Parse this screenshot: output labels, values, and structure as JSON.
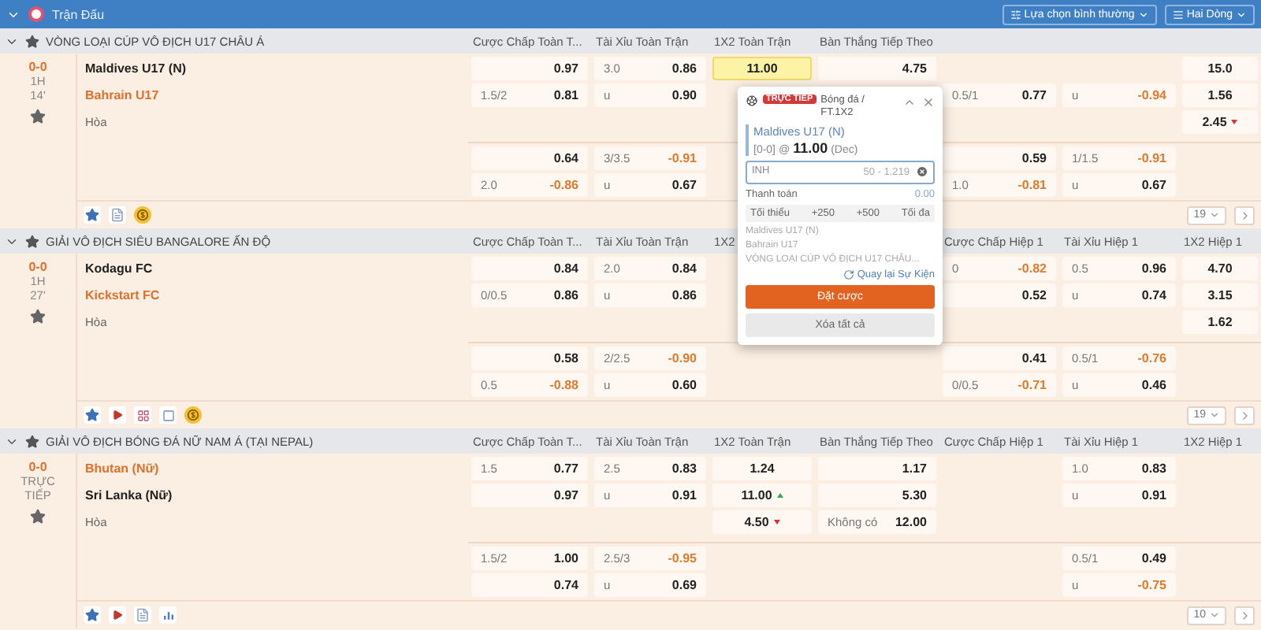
{
  "topbar": {
    "title": "Trận Đấu",
    "options": [
      {
        "label": "Lựa chọn bình thường",
        "kind": "filter"
      },
      {
        "label": "Hai Dòng",
        "kind": "lines"
      }
    ]
  },
  "sections": [
    {
      "league": "VÒNG LOẠI CÚP VÔ ĐỊCH U17 CHÂU Á",
      "columns": [
        {
          "label": "Cược Chấp Toàn T...",
          "kind": "handicap"
        },
        {
          "label": "Tài Xỉu Toàn Trận",
          "kind": "total"
        },
        {
          "label": "1X2 Toàn Trận",
          "kind": "threeway"
        },
        {
          "label": "Bàn Thắng Tiếp Theo",
          "kind": "nextgoal"
        },
        {
          "kind": "handicap"
        },
        {
          "kind": "total"
        },
        {
          "kind": "threeway"
        }
      ],
      "score": "0-0",
      "status": [
        "1H",
        "14'"
      ],
      "teams": [
        {
          "name": "Maldives U17 (N)",
          "highlight": false
        },
        {
          "name": "Bahrain U17",
          "highlight": true
        }
      ],
      "draw": "Hòa",
      "blocks": [
        {
          "rows": [
            [
              {
                "odds": "0.97",
                "negative": false,
                "selected": false
              },
              {
                "line": "3.0",
                "odds": "0.86",
                "negative": false,
                "selected": false
              },
              {
                "odds": "11.00",
                "negative": false,
                "selected": true
              },
              {
                "odds": "4.75",
                "negative": false,
                "selected": false
              },
              null,
              null,
              {
                "odds": "15.0",
                "negative": false,
                "selected": false
              }
            ],
            [
              {
                "line": "1.5/2",
                "odds": "0.81",
                "negative": false,
                "selected": false
              },
              {
                "line": "u",
                "odds": "0.90",
                "negative": false,
                "selected": false
              },
              null,
              null,
              {
                "line": "0.5/1",
                "odds": "0.77",
                "negative": false,
                "selected": false
              },
              {
                "line": "u",
                "odds": "-0.94",
                "negative": true,
                "selected": false
              },
              {
                "odds": "1.56",
                "negative": false,
                "selected": false
              }
            ],
            [
              null,
              null,
              null,
              null,
              null,
              null,
              {
                "odds": "2.45",
                "negative": false,
                "selected": false,
                "trend": {
                  "kind": "down"
                }
              }
            ]
          ]
        },
        {
          "rows": [
            [
              {
                "odds": "0.64",
                "negative": false,
                "selected": false
              },
              {
                "line": "3/3.5",
                "odds": "-0.91",
                "negative": true,
                "selected": false
              },
              null,
              null,
              {
                "odds": "0.59",
                "negative": false,
                "selected": false
              },
              {
                "line": "1/1.5",
                "odds": "-0.91",
                "negative": true,
                "selected": false
              },
              null
            ],
            [
              {
                "line": "2.0",
                "odds": "-0.86",
                "negative": true,
                "selected": false
              },
              {
                "line": "u",
                "odds": "0.67",
                "negative": false,
                "selected": false
              },
              null,
              null,
              {
                "line": "1.0",
                "odds": "-0.81",
                "negative": true,
                "selected": false
              },
              {
                "line": "u",
                "odds": "0.67",
                "negative": false,
                "selected": false
              },
              null
            ]
          ]
        }
      ],
      "tools": [
        {
          "kind": "star"
        },
        {
          "kind": "list"
        },
        {
          "kind": "coin"
        }
      ],
      "page_size": "19"
    },
    {
      "league": "GIẢI VÔ ĐỊCH SIÊU BANGALORE ẤN ĐỘ",
      "columns": [
        {
          "label": "Cược Chấp Toàn T...",
          "kind": "handicap"
        },
        {
          "label": "Tài Xỉu Toàn Trận",
          "kind": "total"
        },
        {
          "label": "1X2",
          "kind": "threeway"
        },
        {
          "kind": "nextgoal"
        },
        {
          "label": "Cược Chấp Hiệp 1",
          "kind": "handicap"
        },
        {
          "label": "Tài Xỉu Hiệp 1",
          "kind": "total"
        },
        {
          "label": "1X2 Hiệp 1",
          "kind": "threeway"
        }
      ],
      "score": "0-0",
      "status": [
        "1H",
        "27'"
      ],
      "teams": [
        {
          "name": "Kodagu FC",
          "highlight": false
        },
        {
          "name": "Kickstart FC",
          "highlight": true
        }
      ],
      "draw": "Hòa",
      "blocks": [
        {
          "rows": [
            [
              {
                "odds": "0.84",
                "negative": false,
                "selected": false
              },
              {
                "line": "2.0",
                "odds": "0.84",
                "negative": false,
                "selected": false
              },
              null,
              null,
              {
                "line": "0",
                "odds": "-0.82",
                "negative": true,
                "selected": false
              },
              {
                "line": "0.5",
                "odds": "0.96",
                "negative": false,
                "selected": false
              },
              {
                "odds": "4.70",
                "negative": false,
                "selected": false
              }
            ],
            [
              {
                "line": "0/0.5",
                "odds": "0.86",
                "negative": false,
                "selected": false
              },
              {
                "line": "u",
                "odds": "0.86",
                "negative": false,
                "selected": false
              },
              null,
              null,
              {
                "odds": "0.52",
                "negative": false,
                "selected": false
              },
              {
                "line": "u",
                "odds": "0.74",
                "negative": false,
                "selected": false
              },
              {
                "odds": "3.15",
                "negative": false,
                "selected": false
              }
            ],
            [
              null,
              null,
              null,
              null,
              null,
              null,
              {
                "odds": "1.62",
                "negative": false,
                "selected": false
              }
            ]
          ]
        },
        {
          "rows": [
            [
              {
                "odds": "0.58",
                "negative": false,
                "selected": false
              },
              {
                "line": "2/2.5",
                "odds": "-0.90",
                "negative": true,
                "selected": false
              },
              null,
              null,
              {
                "odds": "0.41",
                "negative": false,
                "selected": false
              },
              {
                "line": "0.5/1",
                "odds": "-0.76",
                "negative": true,
                "selected": false
              },
              null
            ],
            [
              {
                "line": "0.5",
                "odds": "-0.88",
                "negative": true,
                "selected": false
              },
              {
                "line": "u",
                "odds": "0.60",
                "negative": false,
                "selected": false
              },
              null,
              null,
              {
                "line": "0/0.5",
                "odds": "-0.71",
                "negative": true,
                "selected": false
              },
              {
                "line": "u",
                "odds": "0.46",
                "negative": false,
                "selected": false
              },
              null
            ]
          ]
        }
      ],
      "tools": [
        {
          "kind": "star"
        },
        {
          "kind": "play"
        },
        {
          "kind": "grid"
        },
        {
          "kind": "square"
        },
        {
          "kind": "coin"
        }
      ],
      "page_size": "19"
    },
    {
      "league": "GIẢI VÔ ĐỊCH BÓNG ĐÁ NỮ NAM Á (TẠI NEPAL)",
      "columns": [
        {
          "label": "Cược Chấp Toàn T...",
          "kind": "handicap"
        },
        {
          "label": "Tài Xỉu Toàn Trận",
          "kind": "total"
        },
        {
          "label": "1X2 Toàn Trận",
          "kind": "threeway"
        },
        {
          "label": "Bàn Thắng Tiếp Theo",
          "kind": "nextgoal"
        },
        {
          "label": "Cược Chấp Hiệp 1",
          "kind": "handicap"
        },
        {
          "label": "Tài Xỉu Hiệp 1",
          "kind": "total"
        },
        {
          "label": "1X2 Hiệp 1",
          "kind": "threeway"
        }
      ],
      "score": "0-0",
      "status": [
        "TRỰC",
        "TIẾP"
      ],
      "teams": [
        {
          "name": "Bhutan (Nữ)",
          "highlight": true
        },
        {
          "name": "Sri Lanka (Nữ)",
          "highlight": false
        }
      ],
      "draw": "Hòa",
      "blocks": [
        {
          "rows": [
            [
              {
                "line": "1.5",
                "odds": "0.77",
                "negative": false,
                "selected": false
              },
              {
                "line": "2.5",
                "odds": "0.83",
                "negative": false,
                "selected": false
              },
              {
                "odds": "1.24",
                "negative": false,
                "selected": false
              },
              {
                "odds": "1.17",
                "negative": false,
                "selected": false
              },
              null,
              {
                "line": "1.0",
                "odds": "0.83",
                "negative": false,
                "selected": false
              },
              null
            ],
            [
              {
                "odds": "0.97",
                "negative": false,
                "selected": false
              },
              {
                "line": "u",
                "odds": "0.91",
                "negative": false,
                "selected": false
              },
              {
                "odds": "11.00",
                "negative": false,
                "selected": false,
                "trend": {
                  "kind": "up"
                }
              },
              {
                "odds": "5.30",
                "negative": false,
                "selected": false
              },
              null,
              {
                "line": "u",
                "odds": "0.91",
                "negative": false,
                "selected": false
              },
              null
            ],
            [
              null,
              null,
              {
                "odds": "4.50",
                "negative": false,
                "selected": false,
                "trend": {
                  "kind": "down"
                }
              },
              {
                "line": "Không có",
                "odds": "12.00",
                "negative": false,
                "selected": false
              },
              null,
              null,
              null
            ]
          ]
        },
        {
          "rows": [
            [
              {
                "line": "1.5/2",
                "odds": "1.00",
                "negative": false,
                "selected": false
              },
              {
                "line": "2.5/3",
                "odds": "-0.95",
                "negative": true,
                "selected": false
              },
              null,
              null,
              null,
              {
                "line": "0.5/1",
                "odds": "0.49",
                "negative": false,
                "selected": false
              },
              null
            ],
            [
              {
                "odds": "0.74",
                "negative": false,
                "selected": false
              },
              {
                "line": "u",
                "odds": "0.69",
                "negative": false,
                "selected": false
              },
              null,
              null,
              null,
              {
                "line": "u",
                "odds": "-0.75",
                "negative": true,
                "selected": false
              },
              null
            ]
          ]
        }
      ],
      "tools": [
        {
          "kind": "star"
        },
        {
          "kind": "play"
        },
        {
          "kind": "list"
        },
        {
          "kind": "chart"
        }
      ],
      "page_size": "10"
    }
  ],
  "betslip": {
    "badge": "TRỰC TIẾP",
    "market": "Bóng đá / FT.1X2",
    "selection": "Maldives U17 (N)",
    "score": "[0-0] @",
    "price": "11.00",
    "odds_format": "(Dec)",
    "currency": "INH",
    "placeholder": "50 - 1.219",
    "payout_label": "Thanh toán",
    "payout": "0.00",
    "quick": [
      "Tối thiểu",
      "+250",
      "+500",
      "Tối đa"
    ],
    "details": [
      "Maldives U17 (N)",
      "Bahrain U17",
      "VÒNG LOẠI CÚP VÔ ĐỊCH U17 CHÂU..."
    ],
    "back_link": "Quay lại Sự Kiện",
    "place": "Đặt cược",
    "clear": "Xóa tất cả"
  }
}
